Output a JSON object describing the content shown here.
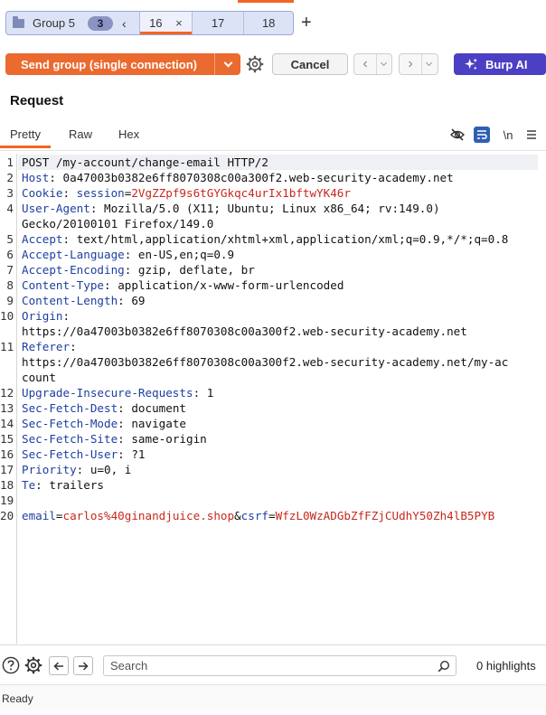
{
  "tabs": {
    "group_name": "Group 5",
    "group_count": "3",
    "items": [
      {
        "label": "16",
        "active": true
      },
      {
        "label": "17",
        "active": false
      },
      {
        "label": "18",
        "active": false
      }
    ],
    "close_glyph": "×",
    "add_glyph": "+"
  },
  "toolbar": {
    "send_label": "Send group (single connection)",
    "cancel_label": "Cancel",
    "burp_ai_label": "Burp AI"
  },
  "request": {
    "title": "Request",
    "view_tabs": [
      "Pretty",
      "Raw",
      "Hex"
    ],
    "active_view": "Pretty",
    "newline_toggle": "\\n",
    "lines": [
      {
        "n": "1",
        "text": "POST /my-account/change-email HTTP/2"
      },
      {
        "n": "2",
        "key": "Host",
        "value": "0a47003b0382e6ff8070308c00a300f2.web-security-academy.net"
      },
      {
        "n": "3",
        "key": "Cookie",
        "cookie_name": "session",
        "cookie_value": "2VgZZpf9s6tGYGkqc4urIx1bftwYK46r"
      },
      {
        "n": "4",
        "key": "User-Agent",
        "value": "Mozilla/5.0 (X11; Ubuntu; Linux x86_64; rv:149.0)"
      },
      {
        "n": "",
        "text": "Gecko/20100101 Firefox/149.0"
      },
      {
        "n": "5",
        "key": "Accept",
        "value": "text/html,application/xhtml+xml,application/xml;q=0.9,*/*;q=0.8"
      },
      {
        "n": "6",
        "key": "Accept-Language",
        "value": "en-US,en;q=0.9"
      },
      {
        "n": "7",
        "key": "Accept-Encoding",
        "value": "gzip, deflate, br"
      },
      {
        "n": "8",
        "key": "Content-Type",
        "value": "application/x-www-form-urlencoded"
      },
      {
        "n": "9",
        "key": "Content-Length",
        "value": "69"
      },
      {
        "n": "10",
        "key": "Origin",
        "value": ""
      },
      {
        "n": "",
        "text": "https://0a47003b0382e6ff8070308c00a300f2.web-security-academy.net"
      },
      {
        "n": "11",
        "key": "Referer",
        "value": ""
      },
      {
        "n": "",
        "text": "https://0a47003b0382e6ff8070308c00a300f2.web-security-academy.net/my-ac"
      },
      {
        "n": "",
        "text": "count"
      },
      {
        "n": "12",
        "key": "Upgrade-Insecure-Requests",
        "value": "1"
      },
      {
        "n": "13",
        "key": "Sec-Fetch-Dest",
        "value": "document"
      },
      {
        "n": "14",
        "key": "Sec-Fetch-Mode",
        "value": "navigate"
      },
      {
        "n": "15",
        "key": "Sec-Fetch-Site",
        "value": "same-origin"
      },
      {
        "n": "16",
        "key": "Sec-Fetch-User",
        "value": "?1"
      },
      {
        "n": "17",
        "key": "Priority",
        "value": "u=0, i"
      },
      {
        "n": "18",
        "key": "Te",
        "value": "trailers"
      },
      {
        "n": "19",
        "text": ""
      },
      {
        "n": "20",
        "body": [
          {
            "k": "email",
            "v": "carlos%40ginandjuice.shop"
          },
          {
            "k": "csrf",
            "v": "WfzL0WzADGbZfFZjCUdhY50Zh4lB5PYB"
          }
        ]
      }
    ]
  },
  "bottom": {
    "search_placeholder": "Search",
    "highlights": "0 highlights"
  },
  "status": {
    "text": "Ready"
  },
  "colors": {
    "accent_orange": "#f26522",
    "send_button": "#ea6a2f",
    "burp_ai": "#4b3fc3",
    "header_key": "#1d3fa0",
    "value_red": "#c8281d"
  },
  "icons": {
    "folder": "folder-icon",
    "gear": "gear-icon",
    "sparkle": "sparkle-icon",
    "eye_off": "eye-off-icon",
    "wrap": "wrap-text-icon",
    "menu": "menu-icon",
    "help": "help-icon",
    "back": "arrow-left-icon",
    "forward": "arrow-right-icon",
    "search": "search-icon"
  }
}
